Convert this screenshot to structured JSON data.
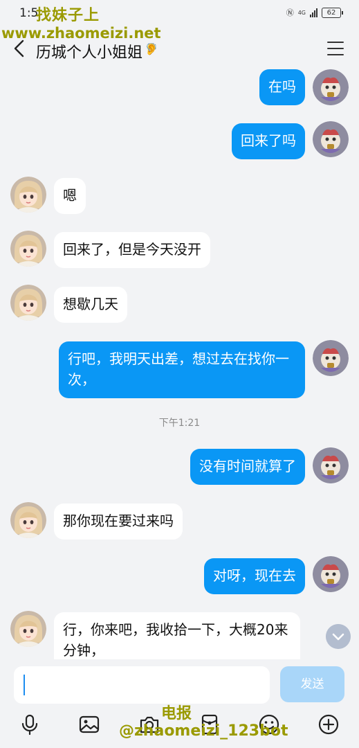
{
  "status": {
    "time": "1:5",
    "net": "4G",
    "battery": "62"
  },
  "watermark": {
    "line1": "找妹子上",
    "line2": "www.zhaomeizi.net",
    "line3": "电报",
    "line4": "@zhaomeizi_123bot"
  },
  "header": {
    "title": "历城个人小姐姐",
    "ear_glyph": "🦻"
  },
  "messages": [
    {
      "dir": "out",
      "text": "在吗"
    },
    {
      "dir": "out",
      "text": "回来了吗"
    },
    {
      "dir": "in",
      "text": "嗯"
    },
    {
      "dir": "in",
      "text": "回来了，但是今天没开"
    },
    {
      "dir": "in",
      "text": "想歇几天"
    },
    {
      "dir": "out",
      "text": "行吧，我明天出差，想过去在找你一次，"
    },
    {
      "dir": "out",
      "text": "没有时间就算了"
    },
    {
      "dir": "in",
      "text": "那你现在要过来吗"
    },
    {
      "dir": "out",
      "text": "对呀，现在去"
    },
    {
      "dir": "in",
      "text": "行，你来吧，我收拾一下，大概20来分钟，"
    }
  ],
  "timestamp": "下午1:21",
  "input": {
    "send_label": "发送",
    "value": ""
  },
  "toolbar": [
    "mic-icon",
    "image-icon",
    "camera-icon",
    "red-packet-icon",
    "emoji-icon",
    "plus-icon"
  ]
}
